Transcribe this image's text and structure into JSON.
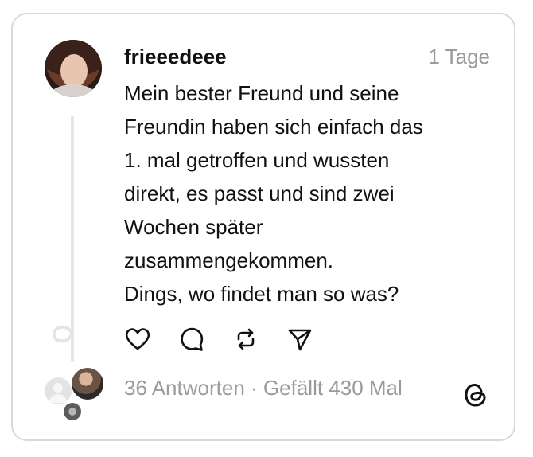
{
  "post": {
    "username": "frieeedeee",
    "time": "1 Tage",
    "text_lines": [
      "Mein bester Freund und seine",
      "Freundin haben sich einfach das",
      "1. mal getroffen und wussten",
      "direkt, es passt und sind zwei",
      "Wochen später",
      "zusammengekommen.",
      "Dings, wo findet man so was?"
    ]
  },
  "actions": {
    "like_icon": "heart-icon",
    "reply_icon": "comment-icon",
    "repost_icon": "repost-icon",
    "share_icon": "send-icon"
  },
  "footer": {
    "replies": "36 Antworten",
    "separator": "·",
    "likes": "Gefällt 430 Mal"
  },
  "brand": {
    "logo": "threads-logo-icon",
    "secondary_text_color": "#9a9a9a",
    "border_color": "#d9d9d9"
  }
}
